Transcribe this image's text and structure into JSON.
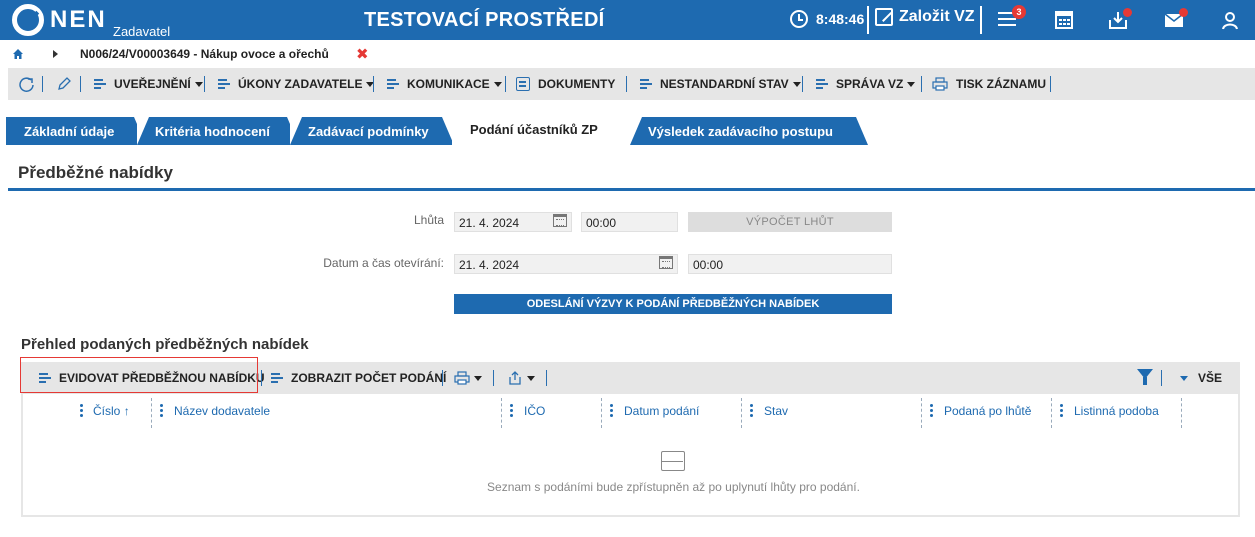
{
  "header": {
    "logo": "NEN",
    "logo_sub": "Zadavatel",
    "env_title": "TESTOVACÍ PROSTŘEDÍ",
    "time": "8:48:46",
    "create_vz": "Založit VZ",
    "menu_badge": "3"
  },
  "breadcrumb": {
    "path": "N006/24/V00003649 - Nákup ovoce a ořechů",
    "close_glyph": "✖"
  },
  "actions": {
    "uverejneni": "UVEŘEJNĚNÍ",
    "ukony": "ÚKONY ZADAVATELE",
    "komunikace": "KOMUNIKACE",
    "dokumenty": "DOKUMENTY",
    "nestandardni": "NESTANDARDNÍ STAV",
    "sprava": "SPRÁVA VZ",
    "tisk": "TISK ZÁZNAMU"
  },
  "tabs": [
    {
      "label": "Základní údaje"
    },
    {
      "label": "Kritéria hodnocení"
    },
    {
      "label": "Zadávací podmínky"
    },
    {
      "label": "Podání účastníků ZP"
    },
    {
      "label": "Výsledek zadávacího postupu"
    }
  ],
  "section_title": "Předběžné nabídky",
  "form": {
    "lhuta_label": "Lhůta",
    "lhuta_date": "21. 4. 2024",
    "lhuta_time": "00:00",
    "vypocet_button": "VÝPOČET LHŮT",
    "otevirani_label": "Datum a čas otevírání:",
    "otevirani_date": "21. 4. 2024",
    "otevirani_time": "00:00",
    "send_button": "ODESLÁNÍ VÝZVY K PODÁNÍ PŘEDBĚŽNÝCH NABÍDEK"
  },
  "list": {
    "title": "Přehled podaných předběžných nabídek",
    "evidovat": "EVIDOVAT PŘEDBĚŽNOU NABÍDKU",
    "zobrazit": "ZOBRAZIT POČET PODÁNÍ",
    "vse": "VŠE",
    "columns": [
      "Číslo",
      "Název dodavatele",
      "IČO",
      "Datum podání",
      "Stav",
      "Podaná po lhůtě",
      "Listinná podoba"
    ],
    "sort_glyph": "↑",
    "empty_text": "Seznam s podáními bude zpřístupněn až po uplynutí lhůty pro podání."
  },
  "colors": {
    "brand_blue": "#1e6ab0",
    "highlight_red": "#e53935",
    "toolbar_gray": "#e6e6e6"
  }
}
